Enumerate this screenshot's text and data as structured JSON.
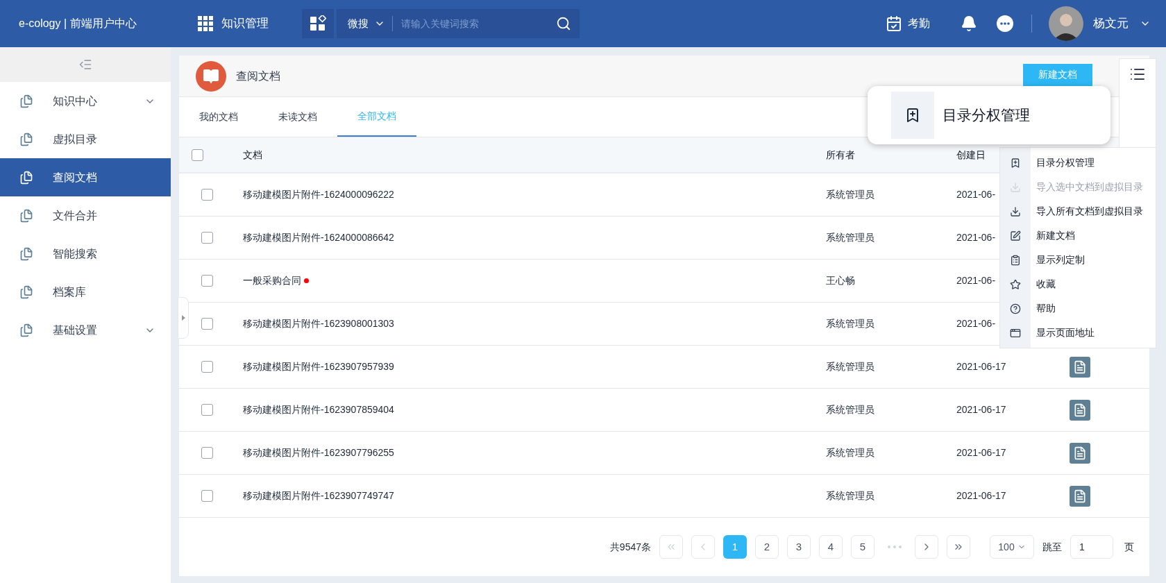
{
  "header": {
    "brand": "e-cology | 前端用户中心",
    "module": "知识管理",
    "search": {
      "scope": "微搜",
      "placeholder": "请输入关键词搜索"
    },
    "attendance": "考勤",
    "user": "杨文元"
  },
  "sidebar": {
    "items": [
      {
        "label": "知识中心",
        "selected": false,
        "has_children": true
      },
      {
        "label": "虚拟目录",
        "selected": false,
        "has_children": false
      },
      {
        "label": "查阅文档",
        "selected": true,
        "has_children": false
      },
      {
        "label": "文件合并",
        "selected": false,
        "has_children": false
      },
      {
        "label": "智能搜索",
        "selected": false,
        "has_children": false
      },
      {
        "label": "档案库",
        "selected": false,
        "has_children": false
      },
      {
        "label": "基础设置",
        "selected": false,
        "has_children": true
      }
    ]
  },
  "page": {
    "title": "查阅文档",
    "new_button": "新建文档"
  },
  "tabs": [
    {
      "label": "我的文档",
      "selected": false
    },
    {
      "label": "未读文档",
      "selected": false
    },
    {
      "label": "全部文档",
      "selected": true
    }
  ],
  "table": {
    "select_all_checked": false,
    "columns": [
      "文档",
      "所有者",
      "创建日"
    ],
    "rows": [
      {
        "checked": false,
        "name": "移动建模图片附件-1624000096222",
        "unread": false,
        "owner": "系统管理员",
        "date": "2021-06-"
      },
      {
        "checked": false,
        "name": "移动建模图片附件-1624000086642",
        "unread": false,
        "owner": "系统管理员",
        "date": "2021-06-"
      },
      {
        "checked": false,
        "name": "一般采购合同",
        "unread": true,
        "owner": "王心畅",
        "date": "2021-06-"
      },
      {
        "checked": false,
        "name": "移动建模图片附件-1623908001303",
        "unread": false,
        "owner": "系统管理员",
        "date": "2021-06-"
      },
      {
        "checked": false,
        "name": "移动建模图片附件-1623907957939",
        "unread": false,
        "owner": "系统管理员",
        "date": "2021-06-17",
        "file_icon": true
      },
      {
        "checked": false,
        "name": "移动建模图片附件-1623907859404",
        "unread": false,
        "owner": "系统管理员",
        "date": "2021-06-17",
        "file_icon": true
      },
      {
        "checked": false,
        "name": "移动建模图片附件-1623907796255",
        "unread": false,
        "owner": "系统管理员",
        "date": "2021-06-17",
        "file_icon": true
      },
      {
        "checked": false,
        "name": "移动建模图片附件-1623907749747",
        "unread": false,
        "owner": "系统管理员",
        "date": "2021-06-17",
        "file_icon": true
      }
    ]
  },
  "menu": {
    "items": [
      {
        "kind": "permission",
        "label": "目录分权管理",
        "disabled": false
      },
      {
        "kind": "import",
        "label": "导入选中文档到虚拟目录",
        "disabled": true
      },
      {
        "kind": "import",
        "label": "导入所有文档到虚拟目录",
        "disabled": false
      },
      {
        "kind": "edit",
        "label": "新建文档",
        "disabled": false
      },
      {
        "kind": "columns",
        "label": "显示列定制",
        "disabled": false
      },
      {
        "kind": "star",
        "label": "收藏",
        "disabled": false
      },
      {
        "kind": "help",
        "label": "帮助",
        "disabled": false
      },
      {
        "kind": "window",
        "label": "显示页面地址",
        "disabled": false
      }
    ]
  },
  "magnifier": {
    "label": "目录分权管理"
  },
  "pagination": {
    "total": "共9547条",
    "pages": [
      {
        "label": "1",
        "selected": true
      },
      {
        "label": "2",
        "selected": false
      },
      {
        "label": "3",
        "selected": false
      },
      {
        "label": "4",
        "selected": false
      },
      {
        "label": "5",
        "selected": false
      }
    ],
    "page_size": "100",
    "jump_label": "跳至",
    "jump_value": "1",
    "page_unit": "页"
  }
}
